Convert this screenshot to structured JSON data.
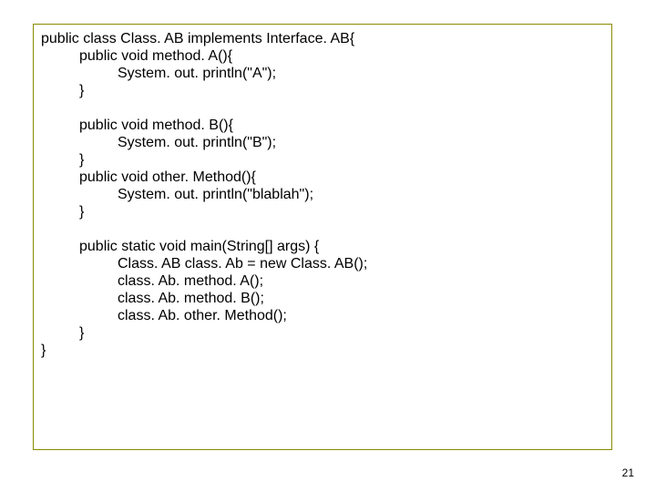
{
  "code": {
    "l01": "public class Class. AB implements Interface. AB{",
    "l02": "public void method. A(){",
    "l03": "System. out. println(\"A\");",
    "l04": "}",
    "l05": "public void method. B(){",
    "l06": "System. out. println(\"B\");",
    "l07": "}",
    "l08": "public void other. Method(){",
    "l09": "System. out. println(\"blablah\");",
    "l10": "}",
    "l11": "public static void main(String[] args) {",
    "l12": "Class. AB class. Ab = new Class. AB();",
    "l13": "class. Ab. method. A();",
    "l14": "class. Ab. method. B();",
    "l15": "class. Ab. other. Method();",
    "l16": "}",
    "l17": "}"
  },
  "pagenum": "21"
}
